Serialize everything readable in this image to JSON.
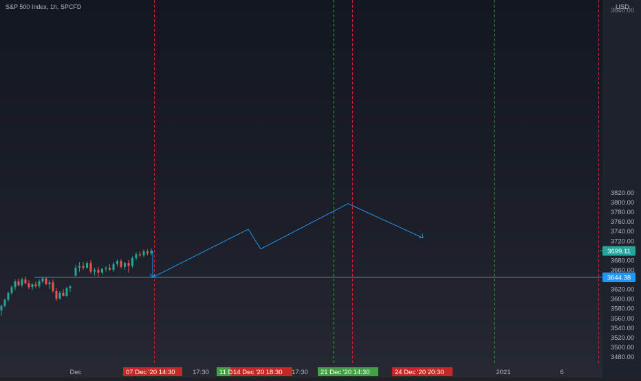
{
  "header": {
    "title": "S&P 500 Index, 1h, SPCFD",
    "currency": "USD"
  },
  "colors": {
    "up": "#26a69a",
    "down": "#ef5350",
    "projection": "#2196f3",
    "horizontal_line": "#2196f3",
    "red_vline": "#c62828",
    "green_vline": "#43a047",
    "current_price_badge": "#26a69a",
    "hline_badge": "#2196f3"
  },
  "chart_data": {
    "type": "candlestick",
    "title": "S&P 500 Index, 1h, SPCFD",
    "ylabel": "USD",
    "ylim": [
      3470,
      3850
    ],
    "grid": false,
    "y_ticks": [
      3480,
      3500,
      3520,
      3540,
      3560,
      3580,
      3600,
      3620,
      3640,
      3660,
      3680,
      3700,
      3720,
      3740,
      3760,
      3780,
      3800,
      3820
    ],
    "y_tick_top_partial": "3840.00",
    "x_labels": [
      {
        "text": "Dec",
        "x": 1
      },
      {
        "text": "17:30",
        "x": 20
      },
      {
        "text": "17:30",
        "x": 36
      },
      {
        "text": "2021",
        "x": 67
      },
      {
        "text": "6",
        "x": 75
      }
    ],
    "candles_approx": [
      [
        3576,
        3588,
        3565,
        3585
      ],
      [
        3585,
        3600,
        3582,
        3598
      ],
      [
        3598,
        3615,
        3594,
        3612
      ],
      [
        3612,
        3628,
        3608,
        3624
      ],
      [
        3624,
        3640,
        3618,
        3636
      ],
      [
        3636,
        3642,
        3626,
        3628
      ],
      [
        3628,
        3644,
        3624,
        3640
      ],
      [
        3640,
        3646,
        3630,
        3632
      ],
      [
        3632,
        3638,
        3620,
        3624
      ],
      [
        3624,
        3632,
        3618,
        3630
      ],
      [
        3630,
        3636,
        3622,
        3626
      ],
      [
        3626,
        3640,
        3622,
        3636
      ],
      [
        3636,
        3646,
        3632,
        3642
      ],
      [
        3642,
        3645,
        3628,
        3630
      ],
      [
        3630,
        3638,
        3620,
        3634
      ],
      [
        3634,
        3640,
        3612,
        3616
      ],
      [
        3616,
        3622,
        3596,
        3600
      ],
      [
        3600,
        3616,
        3598,
        3612
      ],
      [
        3612,
        3620,
        3605,
        3606
      ],
      [
        3606,
        3624,
        3604,
        3622
      ],
      [
        3622,
        3628,
        3614,
        3626
      ],
      [
        3648,
        3670,
        3646,
        3664
      ],
      [
        3664,
        3676,
        3656,
        3668
      ],
      [
        3668,
        3676,
        3660,
        3664
      ],
      [
        3664,
        3678,
        3662,
        3674
      ],
      [
        3674,
        3680,
        3652,
        3656
      ],
      [
        3656,
        3664,
        3648,
        3660
      ],
      [
        3660,
        3666,
        3646,
        3654
      ],
      [
        3654,
        3664,
        3650,
        3662
      ],
      [
        3662,
        3668,
        3656,
        3664
      ],
      [
        3664,
        3672,
        3658,
        3660
      ],
      [
        3660,
        3676,
        3656,
        3672
      ],
      [
        3672,
        3682,
        3666,
        3678
      ],
      [
        3678,
        3682,
        3662,
        3666
      ],
      [
        3666,
        3676,
        3660,
        3674
      ],
      [
        3674,
        3680,
        3654,
        3668
      ],
      [
        3668,
        3688,
        3664,
        3684
      ],
      [
        3684,
        3696,
        3680,
        3692
      ],
      [
        3692,
        3698,
        3686,
        3690
      ],
      [
        3690,
        3702,
        3686,
        3698
      ],
      [
        3698,
        3702,
        3690,
        3694
      ],
      [
        3694,
        3704,
        3690,
        3699
      ]
    ],
    "projection_path": [
      {
        "x": 16,
        "y": 3644.4
      },
      {
        "x": 35,
        "y": 3744
      },
      {
        "x": 37,
        "y": 3703
      },
      {
        "x": 52,
        "y": 3797
      },
      {
        "x": 63,
        "y": 3726
      }
    ],
    "horizontal_line": {
      "y": 3644.38,
      "label": "3644.38"
    },
    "current_price": {
      "y": 3699.11,
      "label": "3699.11"
    },
    "vertical_markers": [
      {
        "x": 16,
        "color": "red",
        "label": "07 Dec '20   14:30"
      },
      {
        "x": 35,
        "color": "green",
        "label": "11 D"
      },
      {
        "x": 37,
        "color": "red",
        "label": "14 Dec '20   18:30"
      },
      {
        "x": 52,
        "color": "green",
        "label": "21 Dec '20   14:30"
      },
      {
        "x": 63,
        "color": "red",
        "label": "24 Dec '20   20:30"
      }
    ]
  }
}
